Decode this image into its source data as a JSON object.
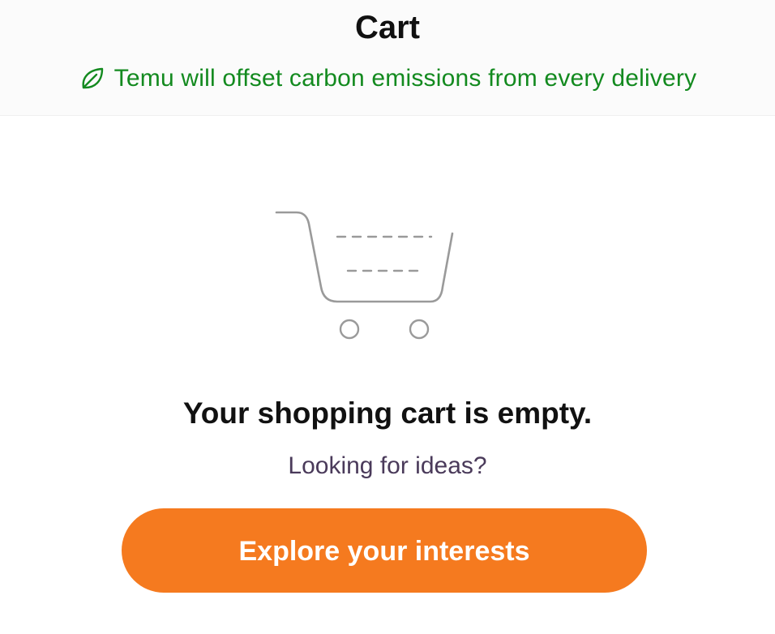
{
  "header": {
    "title": "Cart",
    "carbon_notice": "Temu will offset carbon emissions from every delivery",
    "carbon_icon": "leaf-icon",
    "accent_color": "#138a1f"
  },
  "empty_state": {
    "illustration_icon": "shopping-cart-icon",
    "title": "Your shopping cart is empty.",
    "subtitle": "Looking for ideas?",
    "cta_label": "Explore your interests",
    "cta_color": "#f57a1f"
  }
}
